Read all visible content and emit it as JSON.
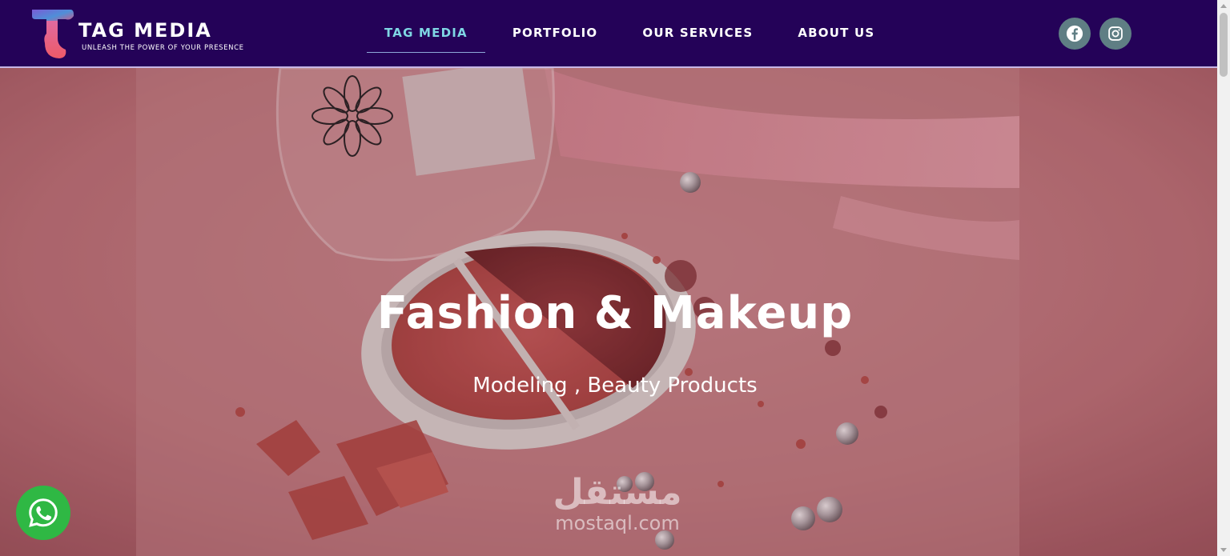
{
  "header": {
    "logo": {
      "title": "TAG MEDIA",
      "tagline": "UNLEASH THE POWER OF YOUR PRESENCE"
    },
    "nav": [
      {
        "label": "TAG MEDIA",
        "active": true
      },
      {
        "label": "PORTFOLIO",
        "active": false
      },
      {
        "label": "OUR SERVICES",
        "active": false
      },
      {
        "label": "ABOUT US",
        "active": false
      }
    ],
    "social": [
      {
        "icon": "facebook-icon"
      },
      {
        "icon": "instagram-icon"
      }
    ]
  },
  "hero": {
    "title": "Fashion & Makeup",
    "subtitle": "Modeling , Beauty Products"
  },
  "watermark": {
    "arabic": "مستقل",
    "latin": "mostaql.com"
  },
  "floating": {
    "icon": "whatsapp-icon"
  },
  "colors": {
    "header_bg": "#240258",
    "nav_active": "#7fd7e4",
    "social_bg": "#5f7e84",
    "whatsapp": "#2fb844"
  }
}
